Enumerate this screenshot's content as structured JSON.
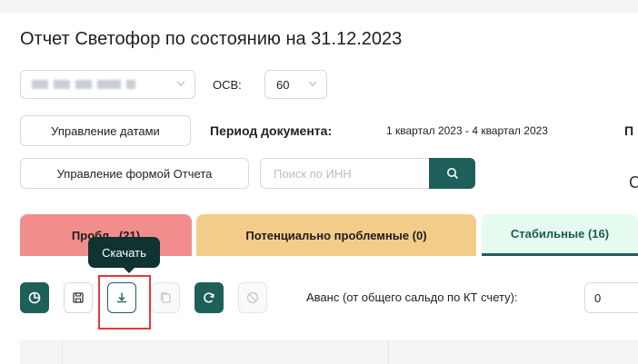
{
  "page": {
    "title": "Отчет Светофор по состоянию на 31.12.2023"
  },
  "filters": {
    "osv_label": "ОСВ:",
    "osv_value": "60"
  },
  "buttons": {
    "manage_dates": "Управление датами",
    "manage_form": "Управление формой Отчета"
  },
  "period": {
    "label": "Период документа:",
    "value": "1 квартал 2023 - 4 квартал 2023",
    "overflow": "П"
  },
  "search": {
    "placeholder": "Поиск по ИНН"
  },
  "right_cut": "С",
  "tabs": {
    "problem": "Пробл   (21)",
    "potential": "Потенциально проблемные (0)",
    "stable": "Стабильные (16)"
  },
  "tooltip": {
    "text": "Скачать"
  },
  "advance": {
    "label": "Аванс (от общего сальдо по КТ счету):",
    "value": "0"
  },
  "colors": {
    "accent": "#1f5f5a",
    "tab_red": "#f28d8d",
    "tab_orange": "#f4cc8a",
    "tab_green": "#e6fbef",
    "highlight": "#e53935"
  },
  "icons": [
    "chart-icon",
    "save-icon",
    "download-icon",
    "copy-icon",
    "refresh-icon",
    "block-icon",
    "search-icon",
    "chevron-down-icon"
  ]
}
